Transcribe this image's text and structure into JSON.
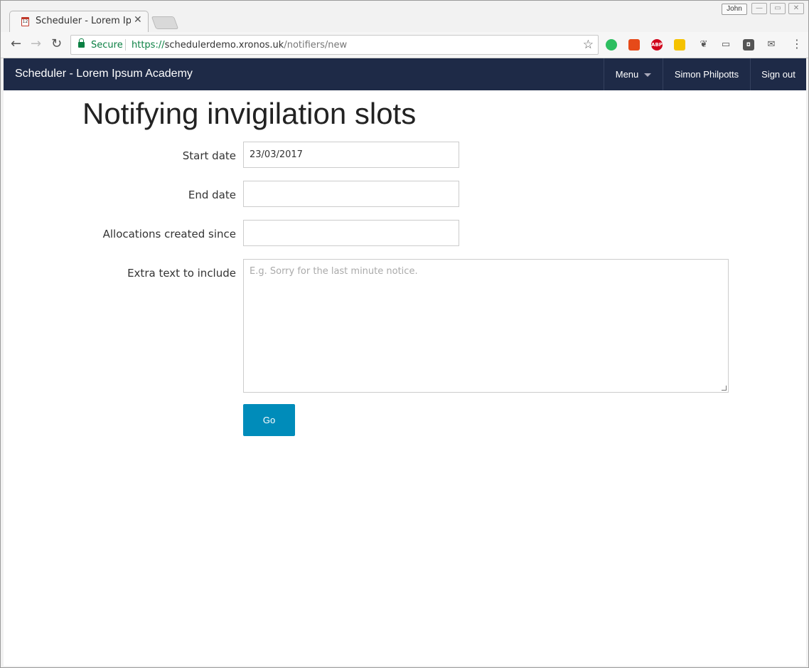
{
  "browser": {
    "tab_title": "Scheduler - Lorem Ipsum Academy",
    "tab_favicon_text": "12",
    "close_glyph": "✕",
    "user_badge": "John",
    "secure_label": "Secure",
    "url_scheme": "https://",
    "url_host": "schedulerdemo.xronos.uk",
    "url_path": "/notifiers/new",
    "extensions": [
      {
        "name": "evernote-icon",
        "color": "#2dbe60",
        "text": ""
      },
      {
        "name": "extension-orange-icon",
        "color": "#e64a19",
        "text": ""
      },
      {
        "name": "adblock-icon",
        "color": "#d0021b",
        "text": "ABP"
      },
      {
        "name": "house-extension-icon",
        "color": "#f5c200",
        "text": ""
      }
    ]
  },
  "navbar": {
    "brand": "Scheduler - Lorem Ipsum Academy",
    "menu_label": "Menu",
    "user_name": "Simon Philpotts",
    "signout_label": "Sign out",
    "background": "#1e2a47"
  },
  "form": {
    "heading": "Notifying invigilation slots",
    "start_date_label": "Start date",
    "start_date_value": "23/03/2017",
    "end_date_label": "End date",
    "end_date_value": "",
    "allocations_label": "Allocations created since",
    "allocations_value": "",
    "extra_text_label": "Extra text to include",
    "extra_text_placeholder": "E.g. Sorry for the last minute notice.",
    "submit_label": "Go",
    "submit_color": "#008cba"
  }
}
